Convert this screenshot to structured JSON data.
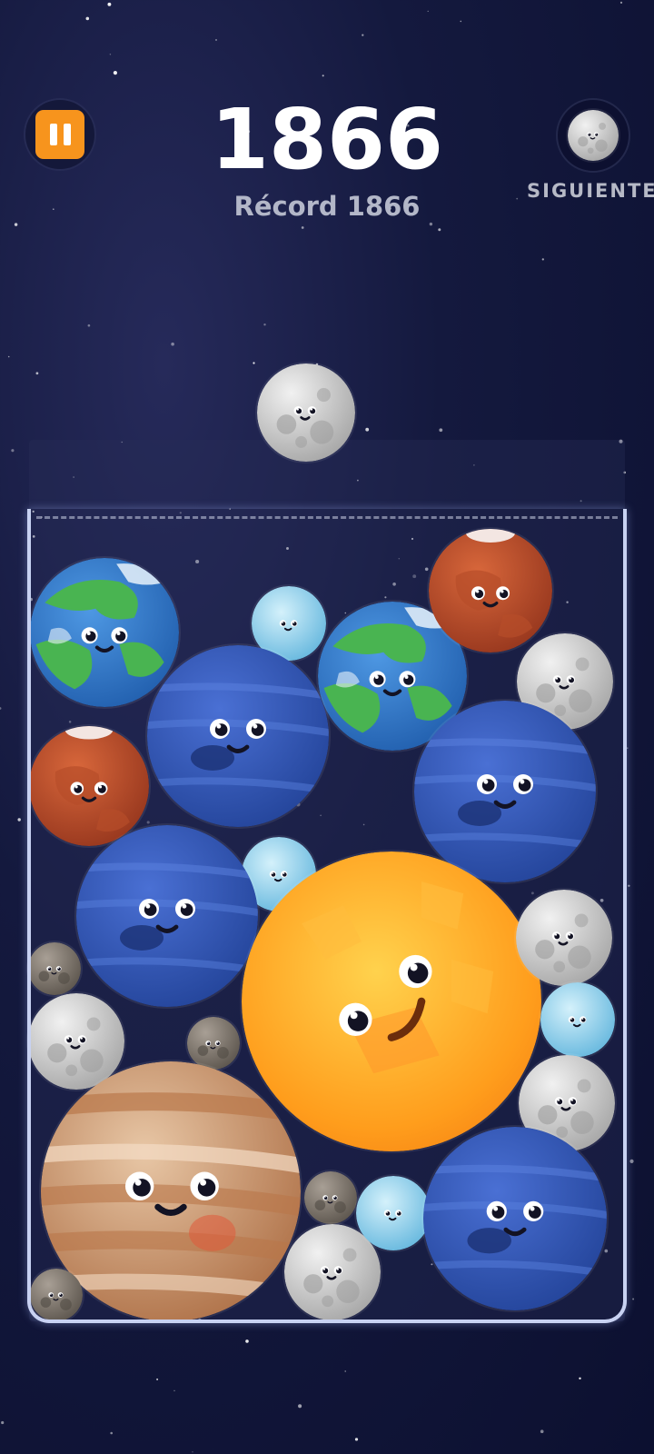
{
  "hud": {
    "pause_icon": "pause-icon",
    "score": "1866",
    "record": "Récord 1866",
    "next_label": "SIGUIENTE",
    "next_planet": "moon"
  },
  "dropper": {
    "planet": "moon"
  },
  "colors": {
    "accent": "#f7941d",
    "background": "#14193e",
    "jar_border": "#c8d2f2",
    "score_text": "#ffffff",
    "record_text": "#b3b7c8"
  },
  "planet_types": [
    "pluto",
    "moon",
    "uranus",
    "mars",
    "earth",
    "neptune",
    "jupiter",
    "sun"
  ],
  "board": {
    "planets": [
      {
        "type": "earth"
      },
      {
        "type": "uranus"
      },
      {
        "type": "earth"
      },
      {
        "type": "mars"
      },
      {
        "type": "moon"
      },
      {
        "type": "neptune"
      },
      {
        "type": "mars"
      },
      {
        "type": "neptune"
      },
      {
        "type": "uranus"
      },
      {
        "type": "neptune"
      },
      {
        "type": "pluto"
      },
      {
        "type": "moon"
      },
      {
        "type": "pluto"
      },
      {
        "type": "sun"
      },
      {
        "type": "moon"
      },
      {
        "type": "uranus"
      },
      {
        "type": "moon"
      },
      {
        "type": "jupiter"
      },
      {
        "type": "pluto"
      },
      {
        "type": "moon"
      },
      {
        "type": "uranus"
      },
      {
        "type": "neptune"
      },
      {
        "type": "pluto"
      }
    ]
  }
}
